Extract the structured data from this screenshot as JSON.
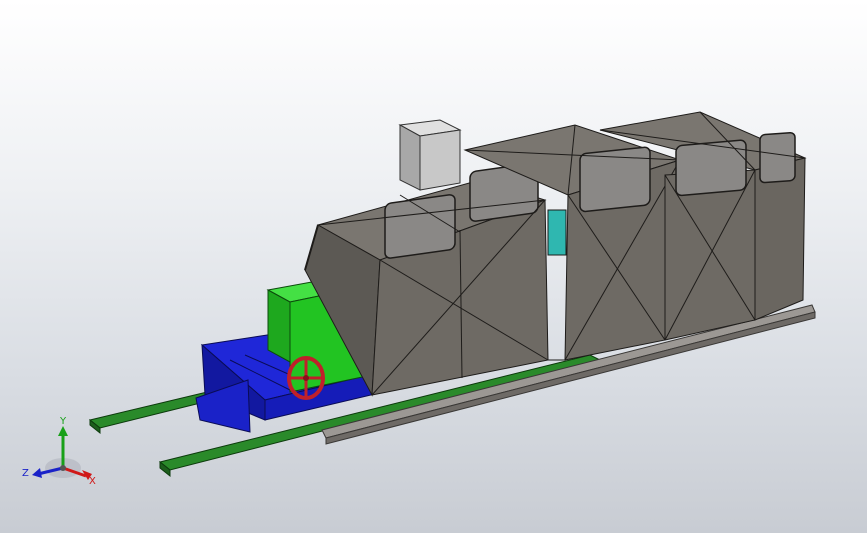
{
  "viewport": {
    "background_top": "#ffffff",
    "background_bottom": "#c8ccd3"
  },
  "model": {
    "parts": [
      {
        "name": "bed-base",
        "color": "#1a20c8"
      },
      {
        "name": "headstock",
        "color": "#22c422"
      },
      {
        "name": "handwheel",
        "color": "#c0202a"
      },
      {
        "name": "rails",
        "color": "#1f7a1f"
      },
      {
        "name": "enclosure",
        "color": "#6e6a64"
      },
      {
        "name": "control-box",
        "color": "#c8c8c8"
      },
      {
        "name": "window-glass",
        "color": "#8a8886"
      },
      {
        "name": "accent-teal",
        "color": "#2fb7b0"
      }
    ]
  },
  "triad": {
    "x_label": "X",
    "y_label": "Y",
    "z_label": "Z",
    "x_color": "#d01818",
    "y_color": "#18a018",
    "z_color": "#1a22c8"
  }
}
